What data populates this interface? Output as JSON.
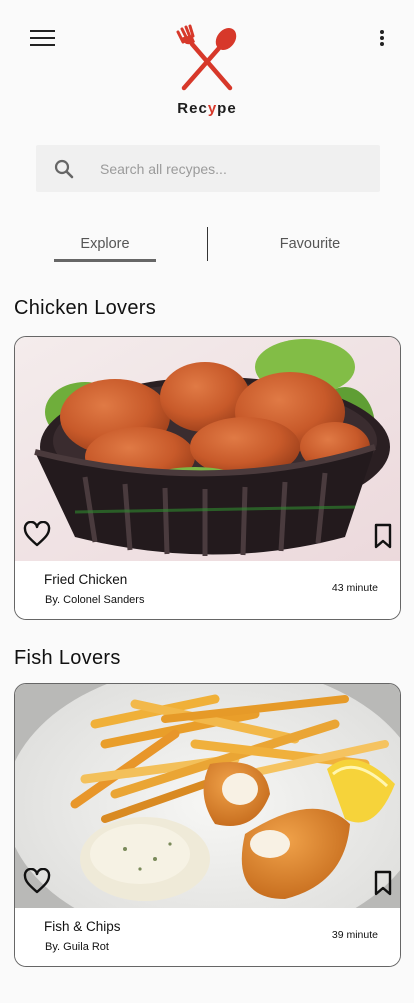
{
  "header": {
    "brand_prefix": "Rec",
    "brand_accent": "y",
    "brand_suffix": "pe",
    "accent_color": "#d7382a"
  },
  "search": {
    "placeholder": "Search all recypes...",
    "value": ""
  },
  "tabs": [
    {
      "label": "Explore",
      "active": true
    },
    {
      "label": "Favourite",
      "active": false
    }
  ],
  "sections": [
    {
      "title": "Chicken Lovers",
      "recipe": {
        "name": "Fried Chicken",
        "author": "By. Colonel Sanders",
        "duration": "43 minute"
      }
    },
    {
      "title": "Fish Lovers",
      "recipe": {
        "name": "Fish & Chips",
        "author": "By. Guila Rot",
        "duration": "39 minute"
      }
    }
  ],
  "icons": {
    "menu": "hamburger-menu-icon",
    "more": "more-vert-icon",
    "search": "search-icon",
    "favorite": "heart-outline-icon",
    "save": "bookmark-outline-icon",
    "logo": "fork-spoon-crossed-icon"
  }
}
